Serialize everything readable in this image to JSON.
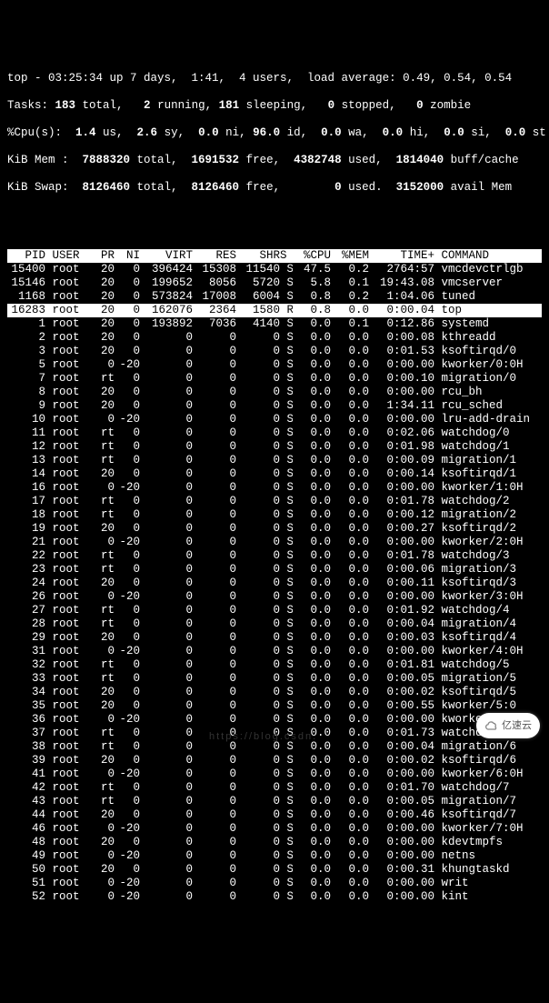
{
  "summary": {
    "line1": "top - 03:25:34 up 7 days,  1:41,  4 users,  load average: 0.49, 0.54, 0.54",
    "tasks_label": "Tasks:",
    "tasks_total": " 183 ",
    "tasks_total_lbl": "total,",
    "tasks_running": "   2 ",
    "tasks_running_lbl": "running,",
    "tasks_sleeping": " 181 ",
    "tasks_sleeping_lbl": "sleeping,",
    "tasks_stopped": "   0 ",
    "tasks_stopped_lbl": "stopped,",
    "tasks_zombie": "   0 ",
    "tasks_zombie_lbl": "zombie",
    "cpu_label": "%Cpu(s):",
    "cpu_us": "  1.4 ",
    "cpu_us_lbl": "us,",
    "cpu_sy": "  2.6 ",
    "cpu_sy_lbl": "sy,",
    "cpu_ni": "  0.0 ",
    "cpu_ni_lbl": "ni,",
    "cpu_id": " 96.0 ",
    "cpu_id_lbl": "id,",
    "cpu_wa": "  0.0 ",
    "cpu_wa_lbl": "wa,",
    "cpu_hi": "  0.0 ",
    "cpu_hi_lbl": "hi,",
    "cpu_si": "  0.0 ",
    "cpu_si_lbl": "si,",
    "cpu_st": "  0.0 ",
    "cpu_st_lbl": "st",
    "mem_label": "KiB Mem :",
    "mem_total": "  7888320 ",
    "mem_total_lbl": "total,",
    "mem_free": "  1691532 ",
    "mem_free_lbl": "free,",
    "mem_used": "  4382748 ",
    "mem_used_lbl": "used,",
    "mem_buff": "  1814040 ",
    "mem_buff_lbl": "buff/cache",
    "swap_label": "KiB Swap:",
    "swap_total": "  8126460 ",
    "swap_total_lbl": "total,",
    "swap_free": "  8126460 ",
    "swap_free_lbl": "free,",
    "swap_used": "        0 ",
    "swap_used_lbl": "used.",
    "swap_avail": "  3152000 ",
    "swap_avail_lbl": "avail Mem"
  },
  "columns": [
    "  PID",
    " USER     ",
    "PR",
    "NI",
    "   VIRT",
    "   RES",
    "  SHR",
    "S",
    " %CPU",
    " %MEM",
    "    TIME+",
    " COMMAND      "
  ],
  "rows": [
    {
      "pid": "15400",
      "user": "root",
      "pr": "20",
      "ni": "0",
      "virt": "396424",
      "res": "15308",
      "shr": "11540",
      "s": "S",
      "cpu": "47.5",
      "mem": "0.2",
      "time": "2764:57",
      "cmd": "vmcdevctrlgb",
      "hi": false
    },
    {
      "pid": "15146",
      "user": "root",
      "pr": "20",
      "ni": "0",
      "virt": "199652",
      "res": "8056",
      "shr": "5720",
      "s": "S",
      "cpu": "5.8",
      "mem": "0.1",
      "time": "19:43.08",
      "cmd": "vmcserver",
      "hi": false
    },
    {
      "pid": "1168",
      "user": "root",
      "pr": "20",
      "ni": "0",
      "virt": "573824",
      "res": "17008",
      "shr": "6004",
      "s": "S",
      "cpu": "0.8",
      "mem": "0.2",
      "time": "1:04.06",
      "cmd": "tuned",
      "hi": false
    },
    {
      "pid": "16283",
      "user": "root",
      "pr": "20",
      "ni": "0",
      "virt": "162076",
      "res": "2364",
      "shr": "1580",
      "s": "R",
      "cpu": "0.8",
      "mem": "0.0",
      "time": "0:00.04",
      "cmd": "top",
      "hi": true
    },
    {
      "pid": "1",
      "user": "root",
      "pr": "20",
      "ni": "0",
      "virt": "193892",
      "res": "7036",
      "shr": "4140",
      "s": "S",
      "cpu": "0.0",
      "mem": "0.1",
      "time": "0:12.86",
      "cmd": "systemd",
      "hi": false
    },
    {
      "pid": "2",
      "user": "root",
      "pr": "20",
      "ni": "0",
      "virt": "0",
      "res": "0",
      "shr": "0",
      "s": "S",
      "cpu": "0.0",
      "mem": "0.0",
      "time": "0:00.08",
      "cmd": "kthreadd",
      "hi": false
    },
    {
      "pid": "3",
      "user": "root",
      "pr": "20",
      "ni": "0",
      "virt": "0",
      "res": "0",
      "shr": "0",
      "s": "S",
      "cpu": "0.0",
      "mem": "0.0",
      "time": "0:01.53",
      "cmd": "ksoftirqd/0",
      "hi": false
    },
    {
      "pid": "5",
      "user": "root",
      "pr": "0",
      "ni": "-20",
      "virt": "0",
      "res": "0",
      "shr": "0",
      "s": "S",
      "cpu": "0.0",
      "mem": "0.0",
      "time": "0:00.00",
      "cmd": "kworker/0:0H",
      "hi": false
    },
    {
      "pid": "7",
      "user": "root",
      "pr": "rt",
      "ni": "0",
      "virt": "0",
      "res": "0",
      "shr": "0",
      "s": "S",
      "cpu": "0.0",
      "mem": "0.0",
      "time": "0:00.10",
      "cmd": "migration/0",
      "hi": false
    },
    {
      "pid": "8",
      "user": "root",
      "pr": "20",
      "ni": "0",
      "virt": "0",
      "res": "0",
      "shr": "0",
      "s": "S",
      "cpu": "0.0",
      "mem": "0.0",
      "time": "0:00.00",
      "cmd": "rcu_bh",
      "hi": false
    },
    {
      "pid": "9",
      "user": "root",
      "pr": "20",
      "ni": "0",
      "virt": "0",
      "res": "0",
      "shr": "0",
      "s": "S",
      "cpu": "0.0",
      "mem": "0.0",
      "time": "1:34.11",
      "cmd": "rcu_sched",
      "hi": false
    },
    {
      "pid": "10",
      "user": "root",
      "pr": "0",
      "ni": "-20",
      "virt": "0",
      "res": "0",
      "shr": "0",
      "s": "S",
      "cpu": "0.0",
      "mem": "0.0",
      "time": "0:00.00",
      "cmd": "lru-add-drain",
      "hi": false
    },
    {
      "pid": "11",
      "user": "root",
      "pr": "rt",
      "ni": "0",
      "virt": "0",
      "res": "0",
      "shr": "0",
      "s": "S",
      "cpu": "0.0",
      "mem": "0.0",
      "time": "0:02.06",
      "cmd": "watchdog/0",
      "hi": false
    },
    {
      "pid": "12",
      "user": "root",
      "pr": "rt",
      "ni": "0",
      "virt": "0",
      "res": "0",
      "shr": "0",
      "s": "S",
      "cpu": "0.0",
      "mem": "0.0",
      "time": "0:01.98",
      "cmd": "watchdog/1",
      "hi": false
    },
    {
      "pid": "13",
      "user": "root",
      "pr": "rt",
      "ni": "0",
      "virt": "0",
      "res": "0",
      "shr": "0",
      "s": "S",
      "cpu": "0.0",
      "mem": "0.0",
      "time": "0:00.09",
      "cmd": "migration/1",
      "hi": false
    },
    {
      "pid": "14",
      "user": "root",
      "pr": "20",
      "ni": "0",
      "virt": "0",
      "res": "0",
      "shr": "0",
      "s": "S",
      "cpu": "0.0",
      "mem": "0.0",
      "time": "0:00.14",
      "cmd": "ksoftirqd/1",
      "hi": false
    },
    {
      "pid": "16",
      "user": "root",
      "pr": "0",
      "ni": "-20",
      "virt": "0",
      "res": "0",
      "shr": "0",
      "s": "S",
      "cpu": "0.0",
      "mem": "0.0",
      "time": "0:00.00",
      "cmd": "kworker/1:0H",
      "hi": false
    },
    {
      "pid": "17",
      "user": "root",
      "pr": "rt",
      "ni": "0",
      "virt": "0",
      "res": "0",
      "shr": "0",
      "s": "S",
      "cpu": "0.0",
      "mem": "0.0",
      "time": "0:01.78",
      "cmd": "watchdog/2",
      "hi": false
    },
    {
      "pid": "18",
      "user": "root",
      "pr": "rt",
      "ni": "0",
      "virt": "0",
      "res": "0",
      "shr": "0",
      "s": "S",
      "cpu": "0.0",
      "mem": "0.0",
      "time": "0:00.12",
      "cmd": "migration/2",
      "hi": false
    },
    {
      "pid": "19",
      "user": "root",
      "pr": "20",
      "ni": "0",
      "virt": "0",
      "res": "0",
      "shr": "0",
      "s": "S",
      "cpu": "0.0",
      "mem": "0.0",
      "time": "0:00.27",
      "cmd": "ksoftirqd/2",
      "hi": false
    },
    {
      "pid": "21",
      "user": "root",
      "pr": "0",
      "ni": "-20",
      "virt": "0",
      "res": "0",
      "shr": "0",
      "s": "S",
      "cpu": "0.0",
      "mem": "0.0",
      "time": "0:00.00",
      "cmd": "kworker/2:0H",
      "hi": false
    },
    {
      "pid": "22",
      "user": "root",
      "pr": "rt",
      "ni": "0",
      "virt": "0",
      "res": "0",
      "shr": "0",
      "s": "S",
      "cpu": "0.0",
      "mem": "0.0",
      "time": "0:01.78",
      "cmd": "watchdog/3",
      "hi": false
    },
    {
      "pid": "23",
      "user": "root",
      "pr": "rt",
      "ni": "0",
      "virt": "0",
      "res": "0",
      "shr": "0",
      "s": "S",
      "cpu": "0.0",
      "mem": "0.0",
      "time": "0:00.06",
      "cmd": "migration/3",
      "hi": false
    },
    {
      "pid": "24",
      "user": "root",
      "pr": "20",
      "ni": "0",
      "virt": "0",
      "res": "0",
      "shr": "0",
      "s": "S",
      "cpu": "0.0",
      "mem": "0.0",
      "time": "0:00.11",
      "cmd": "ksoftirqd/3",
      "hi": false
    },
    {
      "pid": "26",
      "user": "root",
      "pr": "0",
      "ni": "-20",
      "virt": "0",
      "res": "0",
      "shr": "0",
      "s": "S",
      "cpu": "0.0",
      "mem": "0.0",
      "time": "0:00.00",
      "cmd": "kworker/3:0H",
      "hi": false
    },
    {
      "pid": "27",
      "user": "root",
      "pr": "rt",
      "ni": "0",
      "virt": "0",
      "res": "0",
      "shr": "0",
      "s": "S",
      "cpu": "0.0",
      "mem": "0.0",
      "time": "0:01.92",
      "cmd": "watchdog/4",
      "hi": false
    },
    {
      "pid": "28",
      "user": "root",
      "pr": "rt",
      "ni": "0",
      "virt": "0",
      "res": "0",
      "shr": "0",
      "s": "S",
      "cpu": "0.0",
      "mem": "0.0",
      "time": "0:00.04",
      "cmd": "migration/4",
      "hi": false
    },
    {
      "pid": "29",
      "user": "root",
      "pr": "20",
      "ni": "0",
      "virt": "0",
      "res": "0",
      "shr": "0",
      "s": "S",
      "cpu": "0.0",
      "mem": "0.0",
      "time": "0:00.03",
      "cmd": "ksoftirqd/4",
      "hi": false
    },
    {
      "pid": "31",
      "user": "root",
      "pr": "0",
      "ni": "-20",
      "virt": "0",
      "res": "0",
      "shr": "0",
      "s": "S",
      "cpu": "0.0",
      "mem": "0.0",
      "time": "0:00.00",
      "cmd": "kworker/4:0H",
      "hi": false
    },
    {
      "pid": "32",
      "user": "root",
      "pr": "rt",
      "ni": "0",
      "virt": "0",
      "res": "0",
      "shr": "0",
      "s": "S",
      "cpu": "0.0",
      "mem": "0.0",
      "time": "0:01.81",
      "cmd": "watchdog/5",
      "hi": false
    },
    {
      "pid": "33",
      "user": "root",
      "pr": "rt",
      "ni": "0",
      "virt": "0",
      "res": "0",
      "shr": "0",
      "s": "S",
      "cpu": "0.0",
      "mem": "0.0",
      "time": "0:00.05",
      "cmd": "migration/5",
      "hi": false
    },
    {
      "pid": "34",
      "user": "root",
      "pr": "20",
      "ni": "0",
      "virt": "0",
      "res": "0",
      "shr": "0",
      "s": "S",
      "cpu": "0.0",
      "mem": "0.0",
      "time": "0:00.02",
      "cmd": "ksoftirqd/5",
      "hi": false
    },
    {
      "pid": "35",
      "user": "root",
      "pr": "20",
      "ni": "0",
      "virt": "0",
      "res": "0",
      "shr": "0",
      "s": "S",
      "cpu": "0.0",
      "mem": "0.0",
      "time": "0:00.55",
      "cmd": "kworker/5:0",
      "hi": false
    },
    {
      "pid": "36",
      "user": "root",
      "pr": "0",
      "ni": "-20",
      "virt": "0",
      "res": "0",
      "shr": "0",
      "s": "S",
      "cpu": "0.0",
      "mem": "0.0",
      "time": "0:00.00",
      "cmd": "kworker/5:0H",
      "hi": false
    },
    {
      "pid": "37",
      "user": "root",
      "pr": "rt",
      "ni": "0",
      "virt": "0",
      "res": "0",
      "shr": "0",
      "s": "S",
      "cpu": "0.0",
      "mem": "0.0",
      "time": "0:01.73",
      "cmd": "watchdog/6",
      "hi": false
    },
    {
      "pid": "38",
      "user": "root",
      "pr": "rt",
      "ni": "0",
      "virt": "0",
      "res": "0",
      "shr": "0",
      "s": "S",
      "cpu": "0.0",
      "mem": "0.0",
      "time": "0:00.04",
      "cmd": "migration/6",
      "hi": false
    },
    {
      "pid": "39",
      "user": "root",
      "pr": "20",
      "ni": "0",
      "virt": "0",
      "res": "0",
      "shr": "0",
      "s": "S",
      "cpu": "0.0",
      "mem": "0.0",
      "time": "0:00.02",
      "cmd": "ksoftirqd/6",
      "hi": false
    },
    {
      "pid": "41",
      "user": "root",
      "pr": "0",
      "ni": "-20",
      "virt": "0",
      "res": "0",
      "shr": "0",
      "s": "S",
      "cpu": "0.0",
      "mem": "0.0",
      "time": "0:00.00",
      "cmd": "kworker/6:0H",
      "hi": false
    },
    {
      "pid": "42",
      "user": "root",
      "pr": "rt",
      "ni": "0",
      "virt": "0",
      "res": "0",
      "shr": "0",
      "s": "S",
      "cpu": "0.0",
      "mem": "0.0",
      "time": "0:01.70",
      "cmd": "watchdog/7",
      "hi": false
    },
    {
      "pid": "43",
      "user": "root",
      "pr": "rt",
      "ni": "0",
      "virt": "0",
      "res": "0",
      "shr": "0",
      "s": "S",
      "cpu": "0.0",
      "mem": "0.0",
      "time": "0:00.05",
      "cmd": "migration/7",
      "hi": false
    },
    {
      "pid": "44",
      "user": "root",
      "pr": "20",
      "ni": "0",
      "virt": "0",
      "res": "0",
      "shr": "0",
      "s": "S",
      "cpu": "0.0",
      "mem": "0.0",
      "time": "0:00.46",
      "cmd": "ksoftirqd/7",
      "hi": false
    },
    {
      "pid": "46",
      "user": "root",
      "pr": "0",
      "ni": "-20",
      "virt": "0",
      "res": "0",
      "shr": "0",
      "s": "S",
      "cpu": "0.0",
      "mem": "0.0",
      "time": "0:00.00",
      "cmd": "kworker/7:0H",
      "hi": false
    },
    {
      "pid": "48",
      "user": "root",
      "pr": "20",
      "ni": "0",
      "virt": "0",
      "res": "0",
      "shr": "0",
      "s": "S",
      "cpu": "0.0",
      "mem": "0.0",
      "time": "0:00.00",
      "cmd": "kdevtmpfs",
      "hi": false
    },
    {
      "pid": "49",
      "user": "root",
      "pr": "0",
      "ni": "-20",
      "virt": "0",
      "res": "0",
      "shr": "0",
      "s": "S",
      "cpu": "0.0",
      "mem": "0.0",
      "time": "0:00.00",
      "cmd": "netns",
      "hi": false
    },
    {
      "pid": "50",
      "user": "root",
      "pr": "20",
      "ni": "0",
      "virt": "0",
      "res": "0",
      "shr": "0",
      "s": "S",
      "cpu": "0.0",
      "mem": "0.0",
      "time": "0:00.31",
      "cmd": "khungtaskd",
      "hi": false
    },
    {
      "pid": "51",
      "user": "root",
      "pr": "0",
      "ni": "-20",
      "virt": "0",
      "res": "0",
      "shr": "0",
      "s": "S",
      "cpu": "0.0",
      "mem": "0.0",
      "time": "0:00.00",
      "cmd": "writ",
      "hi": false
    },
    {
      "pid": "52",
      "user": "root",
      "pr": "0",
      "ni": "-20",
      "virt": "0",
      "res": "0",
      "shr": "0",
      "s": "S",
      "cpu": "0.0",
      "mem": "0.0",
      "time": "0:00.00",
      "cmd": "kint",
      "hi": false
    }
  ],
  "watermark": "亿速云",
  "faint": "https://blog.csdn."
}
